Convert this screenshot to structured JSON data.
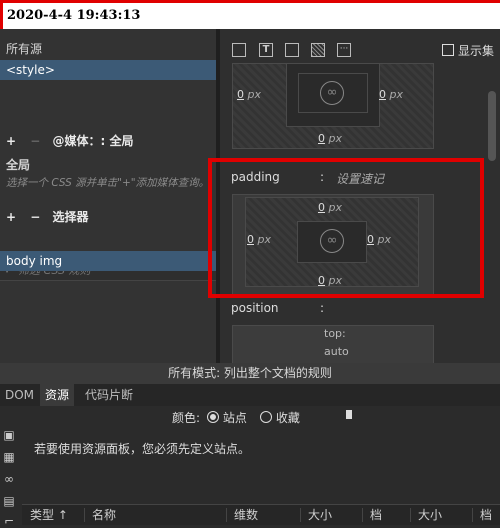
{
  "timestamp": "2020-4-4 19:43:13",
  "left": {
    "source_all": "所有源",
    "source_selected": "<style>",
    "media_header": "@媒体：: 全局",
    "media_item": "全局",
    "media_hint": "选择一个 CSS 源并单击\"+\"添加媒体查询。",
    "selector_header": "选择器",
    "filter_placeholder": "筛选 CSS 规则",
    "selector_item": "body img"
  },
  "right": {
    "show_set": "显示集",
    "margin": {
      "left": "0",
      "right": "0",
      "bottom": "0",
      "unit": "px"
    },
    "padding_label": "padding",
    "padding_colon": ":",
    "padding_shorthand": "设置速记",
    "padding": {
      "top": "0",
      "left": "0",
      "right": "0",
      "bottom": "0",
      "unit": "px"
    },
    "position_label": "position",
    "position_colon": ":",
    "top_label": "top:",
    "top_value": "auto"
  },
  "status": "所有模式: 列出整个文档的规则",
  "tabs": [
    "DOM",
    "资源",
    "代码片断"
  ],
  "resources": {
    "color_label": "颜色:",
    "site": "站点",
    "favorites": "收藏",
    "message": "若要使用资源面板，您必须先定义站点。",
    "columns": [
      "类型",
      "名称",
      "维数",
      "大小",
      "档",
      "大小",
      "档"
    ]
  }
}
